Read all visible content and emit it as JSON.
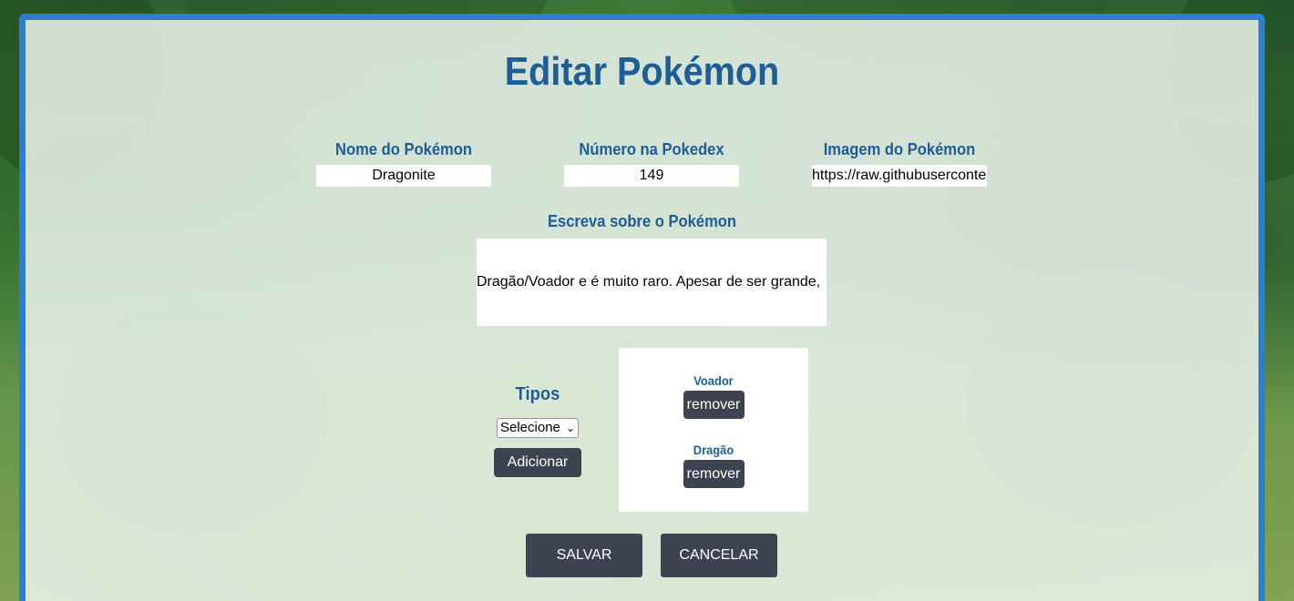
{
  "page": {
    "title": "Editar Pokémon"
  },
  "form": {
    "name": {
      "label": "Nome do Pokémon",
      "value": "Dragonite"
    },
    "number": {
      "label": "Número na Pokedex",
      "value": "149"
    },
    "image": {
      "label": "Imagem do Pokémon",
      "value": "https://raw.githubuserconte"
    },
    "description": {
      "label": "Escreva sobre o Pokémon",
      "value": "Dragão/Voador e é muito raro. Apesar de ser grande,"
    },
    "types": {
      "label": "Tipos",
      "select_value": "Selecione",
      "add_label": "Adicionar",
      "selected": [
        {
          "name": "Voador",
          "remove_label": "remover"
        },
        {
          "name": "Dragão",
          "remove_label": "remover"
        }
      ]
    },
    "actions": {
      "save_label": "SALVAR",
      "cancel_label": "CANCELAR"
    }
  },
  "colors": {
    "accent": "#1e5d96",
    "border": "#2c7ed0",
    "button": "#3d4350"
  }
}
